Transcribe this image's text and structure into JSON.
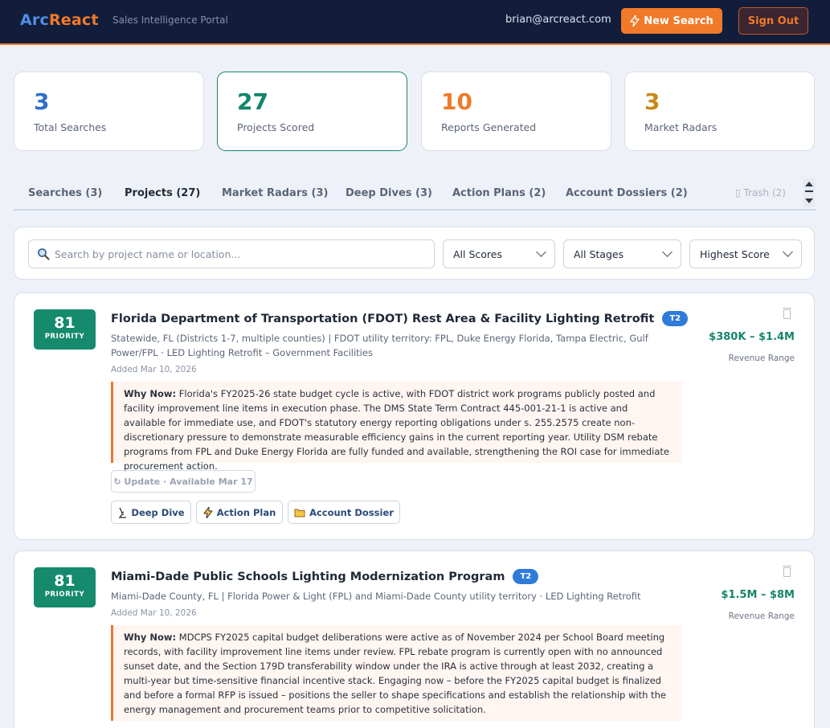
{
  "header": {
    "logo_part1": "Arc",
    "logo_part2": "React",
    "subtitle": "Sales Intelligence Portal",
    "email": "brian@arcreact.com",
    "new_search": "New Search",
    "sign_out": "Sign Out"
  },
  "stats": [
    {
      "value": "3",
      "label": "Total Searches",
      "color": "#2f6fc9"
    },
    {
      "value": "27",
      "label": "Projects Scored",
      "color": "#15856b"
    },
    {
      "value": "10",
      "label": "Reports Generated",
      "color": "#f07a2a"
    },
    {
      "value": "3",
      "label": "Market Radars",
      "color": "#c98a1b"
    }
  ],
  "tabs": [
    "Searches (3)",
    "Projects (27)",
    "Market Radars (3)",
    "Deep Dives (3)",
    "Action Plans (2)",
    "Account Dossiers (2)"
  ],
  "trash_tab": "Trash (2)",
  "filters": {
    "search_placeholder": "Search by project name or location...",
    "score": "All Scores",
    "stage": "All Stages",
    "sort": "Highest Score"
  },
  "projects": [
    {
      "score": "81",
      "priority": "PRIORITY",
      "title": "Florida Department of Transportation (FDOT) Rest Area & Facility Lighting Retrofit",
      "tier": "T2",
      "meta": "Statewide, FL (Districts 1-7, multiple counties) | FDOT utility territory: FPL, Duke Energy Florida, Tampa Electric, Gulf Power/FPL · LED Lighting Retrofit – Government Facilities",
      "added": "Added Mar 10, 2026",
      "why_label": "Why Now:",
      "why_text": "Florida's FY2025-26 state budget cycle is active, with FDOT district work programs publicly posted and facility improvement line items in execution phase. The DMS State Term Contract 445-001-21-1 is active and available for immediate use, and FDOT's statutory energy reporting obligations under s. 255.2575 create non-discretionary pressure to demonstrate measurable efficiency gains in the current reporting year. Utility DSM rebate programs from FPL and Duke Energy Florida are fully funded and available, strengthening the ROI case for immediate procurement action.",
      "update": "Update · Available Mar 17",
      "revenue": "$380K – $1.4M",
      "revenue_label": "Revenue Range",
      "actions": [
        "Deep Dive",
        "Action Plan",
        "Account Dossier"
      ]
    },
    {
      "score": "81",
      "priority": "PRIORITY",
      "title": "Miami-Dade Public Schools Lighting Modernization Program",
      "tier": "T2",
      "meta": "Miami-Dade County, FL | Florida Power & Light (FPL) and Miami-Dade County utility territory · LED Lighting Retrofit",
      "added": "Added Mar 10, 2026",
      "why_label": "Why Now:",
      "why_text": "MDCPS FY2025 capital budget deliberations were active as of November 2024 per School Board meeting records, with facility improvement line items under review. FPL rebate program is currently open with no announced sunset date, and the Section 179D transferability window under the IRA is active through at least 2032, creating a multi-year but time-sensitive financial incentive stack. Engaging now – before the FY2025 capital budget is finalized and before a formal RFP is issued – positions the seller to shape specifications and establish the relationship with the energy management and procurement teams prior to competitive solicitation.",
      "revenue": "$1.5M – $8M",
      "revenue_label": "Revenue Range"
    }
  ]
}
